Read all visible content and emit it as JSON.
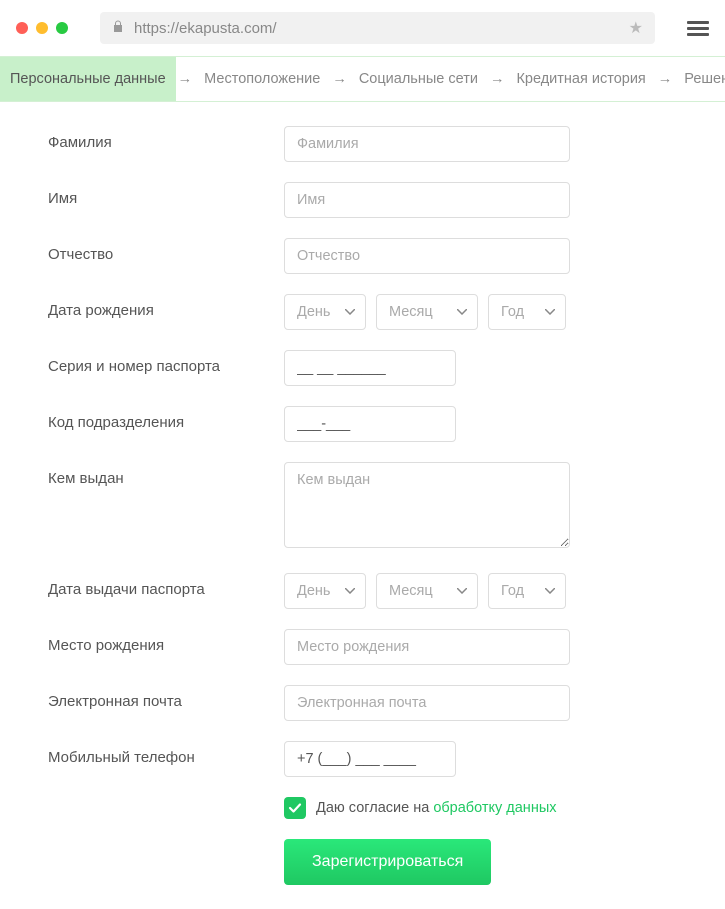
{
  "browser": {
    "url": "https://ekapusta.com/"
  },
  "steps": [
    "Персональные данные",
    "Местоположение",
    "Социальные сети",
    "Кредитная история",
    "Решение"
  ],
  "fields": {
    "surname": {
      "label": "Фамилия",
      "placeholder": "Фамилия"
    },
    "name": {
      "label": "Имя",
      "placeholder": "Имя"
    },
    "patronymic": {
      "label": "Отчество",
      "placeholder": "Отчество"
    },
    "birthdate": {
      "label": "Дата рождения",
      "day": "День",
      "month": "Месяц",
      "year": "Год"
    },
    "passport_sn": {
      "label": "Серия и номер паспорта",
      "value": "__ __ ______"
    },
    "dept_code": {
      "label": "Код подразделения",
      "value": "___-___"
    },
    "issued_by": {
      "label": "Кем выдан",
      "placeholder": "Кем выдан"
    },
    "issue_date": {
      "label": "Дата выдачи паспорта",
      "day": "День",
      "month": "Месяц",
      "year": "Год"
    },
    "birthplace": {
      "label": "Место рождения",
      "placeholder": "Место рождения"
    },
    "email": {
      "label": "Электронная почта",
      "placeholder": "Электронная почта"
    },
    "phone": {
      "label": "Мобильный телефон",
      "value": "+7 (___) ___ ____"
    }
  },
  "consent": {
    "prefix": "Даю согласие на ",
    "link": "обработку данных"
  },
  "submit": "Зарегистрироваться"
}
